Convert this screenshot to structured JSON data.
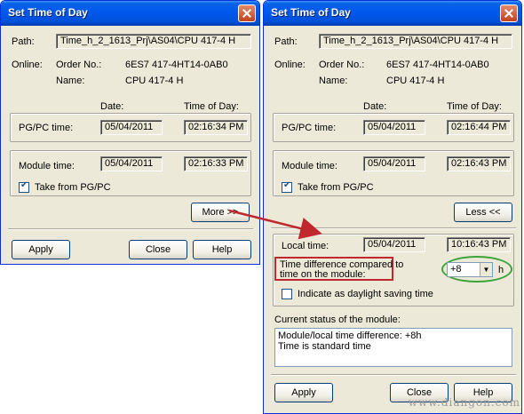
{
  "window_a": {
    "title": "Set Time of Day",
    "path_label": "Path:",
    "path_value": "Time_h_2_1613_Prj\\AS04\\CPU 417-4 H",
    "online_label": "Online:",
    "order_label": "Order No.:",
    "order_value": "6ES7 417-4HT14-0AB0",
    "name_label": "Name:",
    "name_value": "CPU 417-4 H",
    "date_header": "Date:",
    "time_header": "Time of Day:",
    "pgpc_label": "PG/PC time:",
    "pgpc_date": "05/04/2011",
    "pgpc_time": "02:16:34 PM",
    "module_label": "Module time:",
    "module_date": "05/04/2011",
    "module_time": "02:16:33 PM",
    "take_from_label": "Take from PG/PC",
    "more_button": "More >>",
    "apply_button": "Apply",
    "close_button": "Close",
    "help_button": "Help"
  },
  "window_b": {
    "title": "Set Time of Day",
    "path_label": "Path:",
    "path_value": "Time_h_2_1613_Prj\\AS04\\CPU 417-4 H",
    "online_label": "Online:",
    "order_label": "Order No.:",
    "order_value": "6ES7 417-4HT14-0AB0",
    "name_label": "Name:",
    "name_value": "CPU 417-4 H",
    "date_header": "Date:",
    "time_header": "Time of Day:",
    "pgpc_label": "PG/PC time:",
    "pgpc_date": "05/04/2011",
    "pgpc_time": "02:16:44 PM",
    "module_label": "Module time:",
    "module_date": "05/04/2011",
    "module_time": "02:16:43 PM",
    "take_from_label": "Take from PG/PC",
    "less_button": "Less <<",
    "local_label": "Local time:",
    "local_date": "05/04/2011",
    "local_time": "10:16:43 PM",
    "diff_label_line1": "Time difference compared to",
    "diff_label_line2": "time on the module:",
    "diff_value": "+8",
    "diff_unit": "h",
    "daylight_label": "Indicate as daylight saving time",
    "status_label": "Current status of the module:",
    "status_line1": "Module/local time difference: +8h",
    "status_line2": "Time is standard time",
    "apply_button": "Apply",
    "close_button": "Close",
    "help_button": "Help"
  },
  "watermark": "www.diangon.com",
  "colors": {
    "titlebar": "#0058ee",
    "dialog_bg": "#ece9d8",
    "annotation_arrow": "#c0282d",
    "annotation_red_box": "#c0282d",
    "annotation_green_ellipse": "#3aa43a"
  }
}
